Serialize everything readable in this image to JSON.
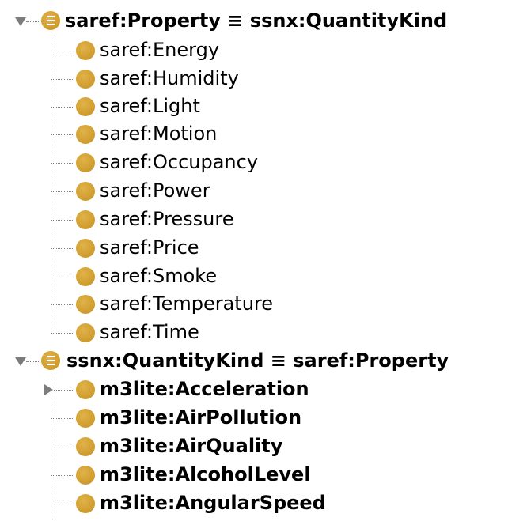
{
  "tree": {
    "roots": [
      {
        "label": "saref:Property ≡ ssnx:QuantityKind",
        "expanded": true,
        "children": [
          {
            "label": "saref:Energy"
          },
          {
            "label": "saref:Humidity"
          },
          {
            "label": "saref:Light"
          },
          {
            "label": "saref:Motion"
          },
          {
            "label": "saref:Occupancy"
          },
          {
            "label": "saref:Power"
          },
          {
            "label": "saref:Pressure"
          },
          {
            "label": "saref:Price"
          },
          {
            "label": "saref:Smoke"
          },
          {
            "label": "saref:Temperature"
          },
          {
            "label": "saref:Time"
          }
        ]
      },
      {
        "label": "ssnx:QuantityKind ≡ saref:Property",
        "expanded": true,
        "children": [
          {
            "label": "m3lite:Acceleration",
            "expandable": true
          },
          {
            "label": "m3lite:AirPollution"
          },
          {
            "label": "m3lite:AirQuality"
          },
          {
            "label": "m3lite:AlcoholLevel"
          },
          {
            "label": "m3lite:AngularSpeed"
          }
        ]
      }
    ]
  },
  "colors": {
    "class_icon": "#d3a032",
    "toggle": "#7c7c7c",
    "connector": "#808080",
    "text": "#000000"
  },
  "icons": {
    "root": "equivalent-class-icon",
    "child": "class-icon",
    "open_toggle": "expanded-triangle-icon",
    "closed_toggle": "collapsed-triangle-icon"
  }
}
